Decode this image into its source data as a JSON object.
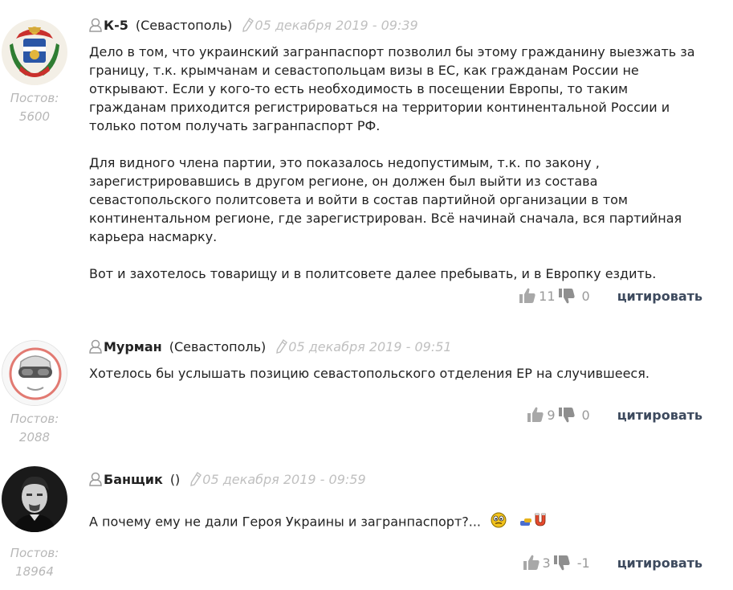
{
  "comments": [
    {
      "author": "К-5",
      "city": "(Севастополь)",
      "date": "05 декабря 2019 - 09:39",
      "posts_label": "Постов:",
      "posts_count": "5600",
      "avatar": "coat-of-arms-avatar",
      "paragraphs": [
        "Дело в том, что украинский загранпаспорт позволил бы этому гражданину выезжать за границу, т.к.  крымчанам и севастопольцам визы в ЕС, как гражданам России не открывают. Если у кого-то есть необходимость в посещении Европы, то  таким гражданам приходится регистрироваться на территории континентальной России и только потом получать загранпаспорт РФ.",
        "Для видного члена партии, это показалось недопустимым, т.к. по закону , зарегистрировавшись в другом регионе, он должен  был выйти из состава севастопольского политсовета  и войти в состав партийной организации в том континентальном  регионе, где зарегистрирован. Всё начинай сначала, вся партийная карьера насмарку.",
        "Вот и захотелось товарищу и в политсовете далее пребывать, и в Европку ездить."
      ],
      "likes": "11",
      "dislikes": "0",
      "quote_label": "цитировать"
    },
    {
      "author": "Мурман",
      "city": "(Севастополь)",
      "date": "05 декабря 2019 - 09:51",
      "posts_label": "Постов:",
      "posts_count": "2088",
      "avatar": "goggles-face-avatar",
      "paragraphs": [
        "Хотелось бы услышать позицию севастопольского отделения ЕР на случившееся."
      ],
      "likes": "9",
      "dislikes": "0",
      "quote_label": "цитировать"
    },
    {
      "author": "Банщик",
      "city": "()",
      "date": "05 декабря 2019 - 09:59",
      "posts_label": "Постов:",
      "posts_count": "18964",
      "avatar": "portrait-photo-avatar",
      "paragraphs": [
        "А почему ему не дали Героя Украины и загранпаспорт?..."
      ],
      "emojis": [
        "confused-face-emoji",
        "magnet-emoji"
      ],
      "likes": "3",
      "dislikes": "-1",
      "quote_label": "цитировать"
    }
  ],
  "colors": {
    "quote_link": "#3d4a5e",
    "muted_text": "#b7b7b7",
    "date_text": "#c0c0c0",
    "icon_gray": "#9a9a9a"
  }
}
